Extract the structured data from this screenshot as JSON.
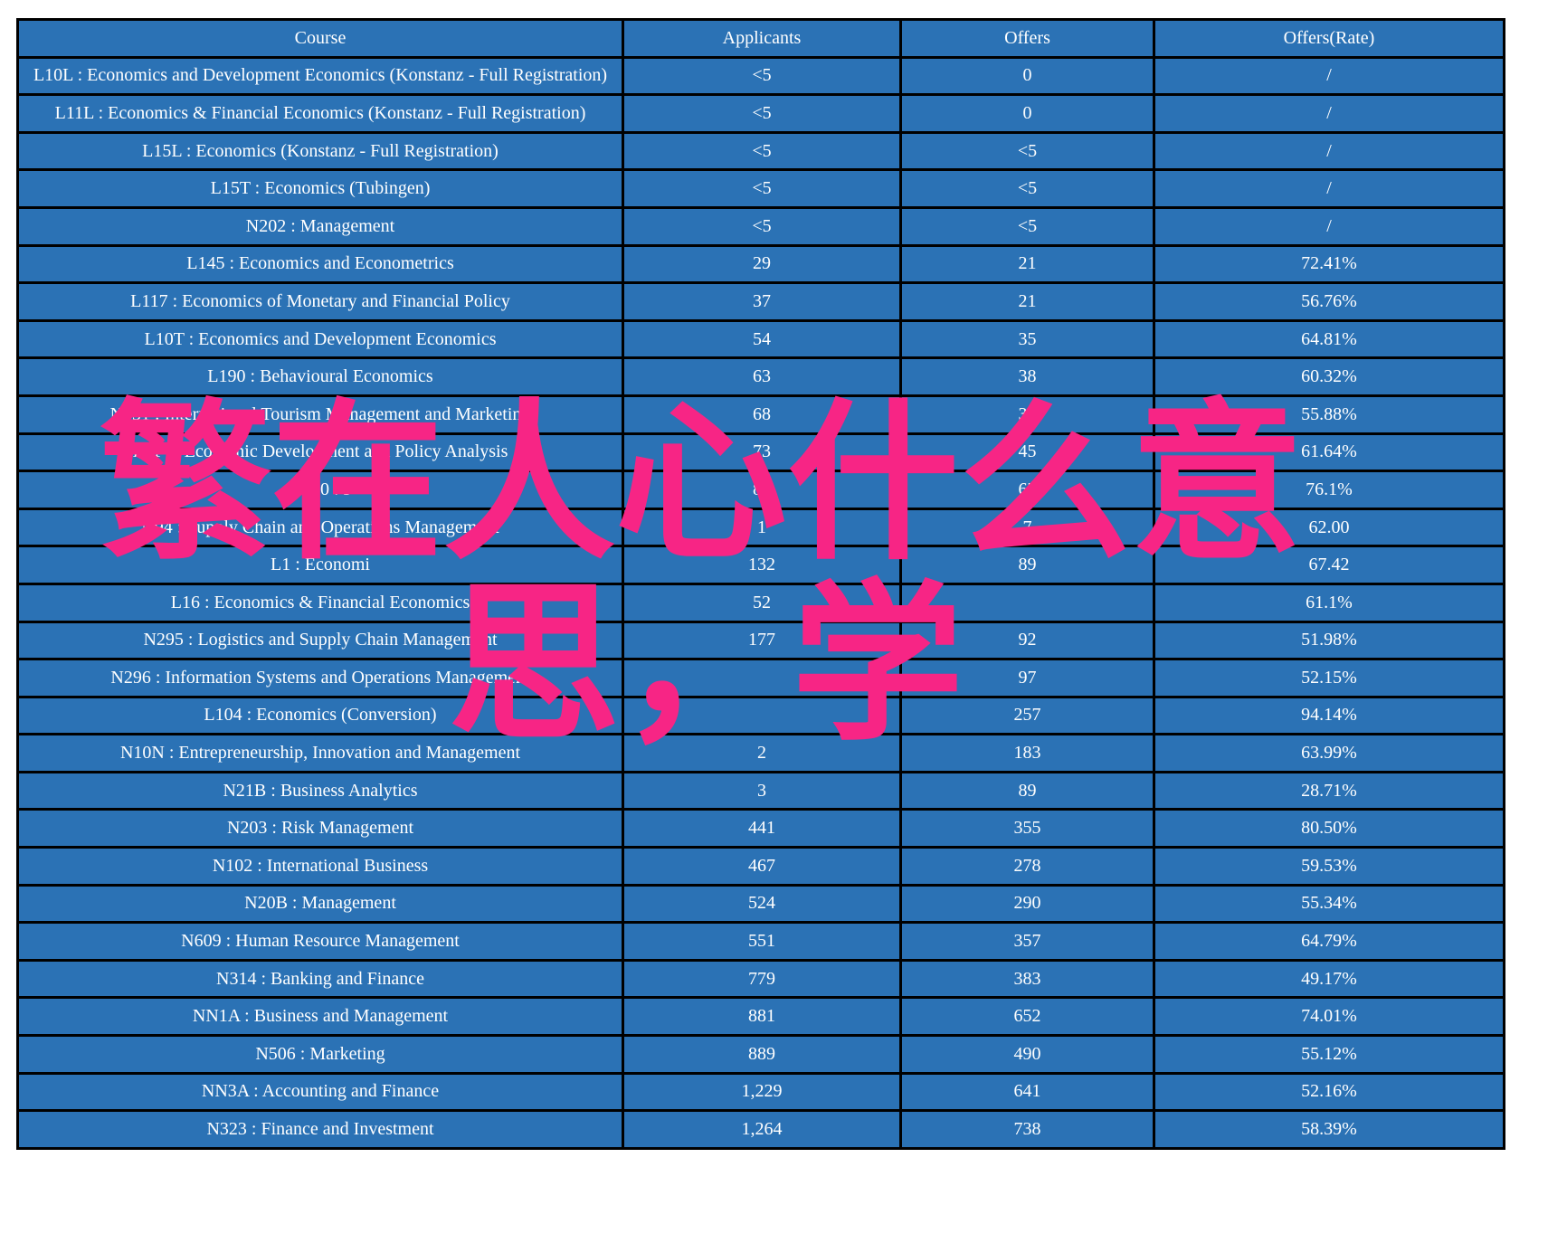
{
  "table": {
    "columns": [
      {
        "key": "course",
        "label": "Course"
      },
      {
        "key": "appl",
        "label": "Applicants"
      },
      {
        "key": "offers",
        "label": "Offers"
      },
      {
        "key": "rate",
        "label": "Offers(Rate)"
      }
    ],
    "colors": {
      "cell_background": "#2b72b5",
      "border": "#000000",
      "text_default": "#ffffff",
      "text_highlight_yellow": "#ffff00",
      "text_highlight_red": "#ff0000",
      "page_background": "#ffffff"
    },
    "rows": [
      {
        "course": "L10L : Economics and Development Economics (Konstanz - Full Registration)",
        "appl": "<5",
        "offers": "0",
        "rate": "/",
        "course_color": "white",
        "appl_color": "white",
        "offers_color": "white",
        "rate_color": "white"
      },
      {
        "course": "L11L : Economics & Financial Economics (Konstanz - Full Registration)",
        "appl": "<5",
        "offers": "0",
        "rate": "/",
        "course_color": "white",
        "appl_color": "white",
        "offers_color": "white",
        "rate_color": "white"
      },
      {
        "course": "L15L : Economics (Konstanz - Full Registration)",
        "appl": "<5",
        "offers": "<5",
        "rate": "/",
        "course_color": "white",
        "appl_color": "white",
        "offers_color": "white",
        "rate_color": "white"
      },
      {
        "course": "L15T : Economics (Tubingen)",
        "appl": "<5",
        "offers": "<5",
        "rate": "/",
        "course_color": "white",
        "appl_color": "white",
        "offers_color": "white",
        "rate_color": "white"
      },
      {
        "course": "N202 : Management",
        "appl": "<5",
        "offers": "<5",
        "rate": "/",
        "course_color": "white",
        "appl_color": "white",
        "offers_color": "white",
        "rate_color": "white"
      },
      {
        "course": "L145 : Economics and Econometrics",
        "appl": "29",
        "offers": "21",
        "rate": "72.41%",
        "course_color": "white",
        "appl_color": "white",
        "offers_color": "white",
        "rate_color": "red"
      },
      {
        "course": "L117 : Economics of Monetary and Financial Policy",
        "appl": "37",
        "offers": "21",
        "rate": "56.76%",
        "course_color": "white",
        "appl_color": "white",
        "offers_color": "white",
        "rate_color": "white"
      },
      {
        "course": "L10T : Economics and Development Economics",
        "appl": "54",
        "offers": "35",
        "rate": "64.81%",
        "course_color": "white",
        "appl_color": "white",
        "offers_color": "white",
        "rate_color": "white"
      },
      {
        "course": "L190 : Behavioural Economics",
        "appl": "63",
        "offers": "38",
        "rate": "60.32%",
        "course_color": "white",
        "appl_color": "white",
        "offers_color": "white",
        "rate_color": "white"
      },
      {
        "course": "N831 : International Tourism Management and Marketing",
        "appl": "68",
        "offers": "38",
        "rate": "55.88%",
        "course_color": "white",
        "appl_color": "white",
        "offers_color": "white",
        "rate_color": "white"
      },
      {
        "course": "L114 : Economic Development and Policy Analysis",
        "appl": "73",
        "offers": "45",
        "rate": "61.64%",
        "course_color": "white",
        "appl_color": "white",
        "offers_color": "white",
        "rate_color": "white"
      },
      {
        "course": "L160 : I",
        "appl": "88",
        "offers": "67",
        "rate": "76.1%",
        "course_color": "white",
        "appl_color": "white",
        "offers_color": "white",
        "rate_color": "red"
      },
      {
        "course": "N94 : Supply Chain and Operations Management",
        "appl": "1",
        "offers": "7",
        "rate": "62.00",
        "course_color": "white",
        "appl_color": "white",
        "offers_color": "white",
        "rate_color": "white"
      },
      {
        "course": "L1 : Economi",
        "appl": "132",
        "offers": "89",
        "rate": "67.42",
        "course_color": "white",
        "appl_color": "white",
        "offers_color": "white",
        "rate_color": "white"
      },
      {
        "course": "L16 : Economics & Financial Economics",
        "appl": "52",
        "offers": "",
        "rate": "61.1%",
        "course_color": "white",
        "appl_color": "white",
        "offers_color": "white",
        "rate_color": "white"
      },
      {
        "course": "N295 : Logistics and Supply Chain Management",
        "appl": "177",
        "offers": "92",
        "rate": "51.98%",
        "course_color": "white",
        "appl_color": "white",
        "offers_color": "white",
        "rate_color": "white"
      },
      {
        "course": "N296 : Information Systems and Operations Management",
        "appl": "",
        "offers": "97",
        "rate": "52.15%",
        "course_color": "white",
        "appl_color": "white",
        "offers_color": "white",
        "rate_color": "white"
      },
      {
        "course": "L104 : Economics (Conversion)",
        "appl": "",
        "offers": "257",
        "rate": "94.14%",
        "course_color": "white",
        "appl_color": "white",
        "offers_color": "white",
        "rate_color": "red"
      },
      {
        "course": "N10N : Entrepreneurship, Innovation and Management",
        "appl": "2",
        "offers": "183",
        "rate": "63.99%",
        "course_color": "white",
        "appl_color": "white",
        "offers_color": "white",
        "rate_color": "white"
      },
      {
        "course": "N21B : Business Analytics",
        "appl": "3",
        "offers": "89",
        "rate": "28.71%",
        "course_color": "white",
        "appl_color": "white",
        "offers_color": "white",
        "rate_color": "white"
      },
      {
        "course": "N203 : Risk Management",
        "appl": "441",
        "offers": "355",
        "rate": "80.50%",
        "course_color": "white",
        "appl_color": "white",
        "offers_color": "white",
        "rate_color": "red"
      },
      {
        "course": "N102 : International Business",
        "appl": "467",
        "offers": "278",
        "rate": "59.53%",
        "course_color": "white",
        "appl_color": "white",
        "offers_color": "white",
        "rate_color": "white"
      },
      {
        "course": "N20B : Management",
        "appl": "524",
        "offers": "290",
        "rate": "55.34%",
        "course_color": "yellow",
        "appl_color": "yellow",
        "offers_color": "white",
        "rate_color": "white"
      },
      {
        "course": "N609 : Human Resource Management",
        "appl": "551",
        "offers": "357",
        "rate": "64.79%",
        "course_color": "yellow",
        "appl_color": "yellow",
        "offers_color": "white",
        "rate_color": "white"
      },
      {
        "course": "N314 : Banking and Finance",
        "appl": "779",
        "offers": "383",
        "rate": "49.17%",
        "course_color": "yellow",
        "appl_color": "yellow",
        "offers_color": "white",
        "rate_color": "white"
      },
      {
        "course": "NN1A : Business and Management",
        "appl": "881",
        "offers": "652",
        "rate": "74.01%",
        "course_color": "yellow",
        "appl_color": "yellow",
        "offers_color": "white",
        "rate_color": "red"
      },
      {
        "course": "N506 : Marketing",
        "appl": "889",
        "offers": "490",
        "rate": "55.12%",
        "course_color": "yellow",
        "appl_color": "yellow",
        "offers_color": "white",
        "rate_color": "white"
      },
      {
        "course": "NN3A : Accounting and Finance",
        "appl": "1,229",
        "offers": "641",
        "rate": "52.16%",
        "course_color": "yellow",
        "appl_color": "yellow",
        "offers_color": "white",
        "rate_color": "white"
      },
      {
        "course": "N323 : Finance and Investment",
        "appl": "1,264",
        "offers": "738",
        "rate": "58.39%",
        "course_color": "yellow",
        "appl_color": "yellow",
        "offers_color": "white",
        "rate_color": "white"
      }
    ]
  },
  "watermark": {
    "color": "#f72585",
    "line1": "繁在人心什么意",
    "line2": "思，学"
  }
}
